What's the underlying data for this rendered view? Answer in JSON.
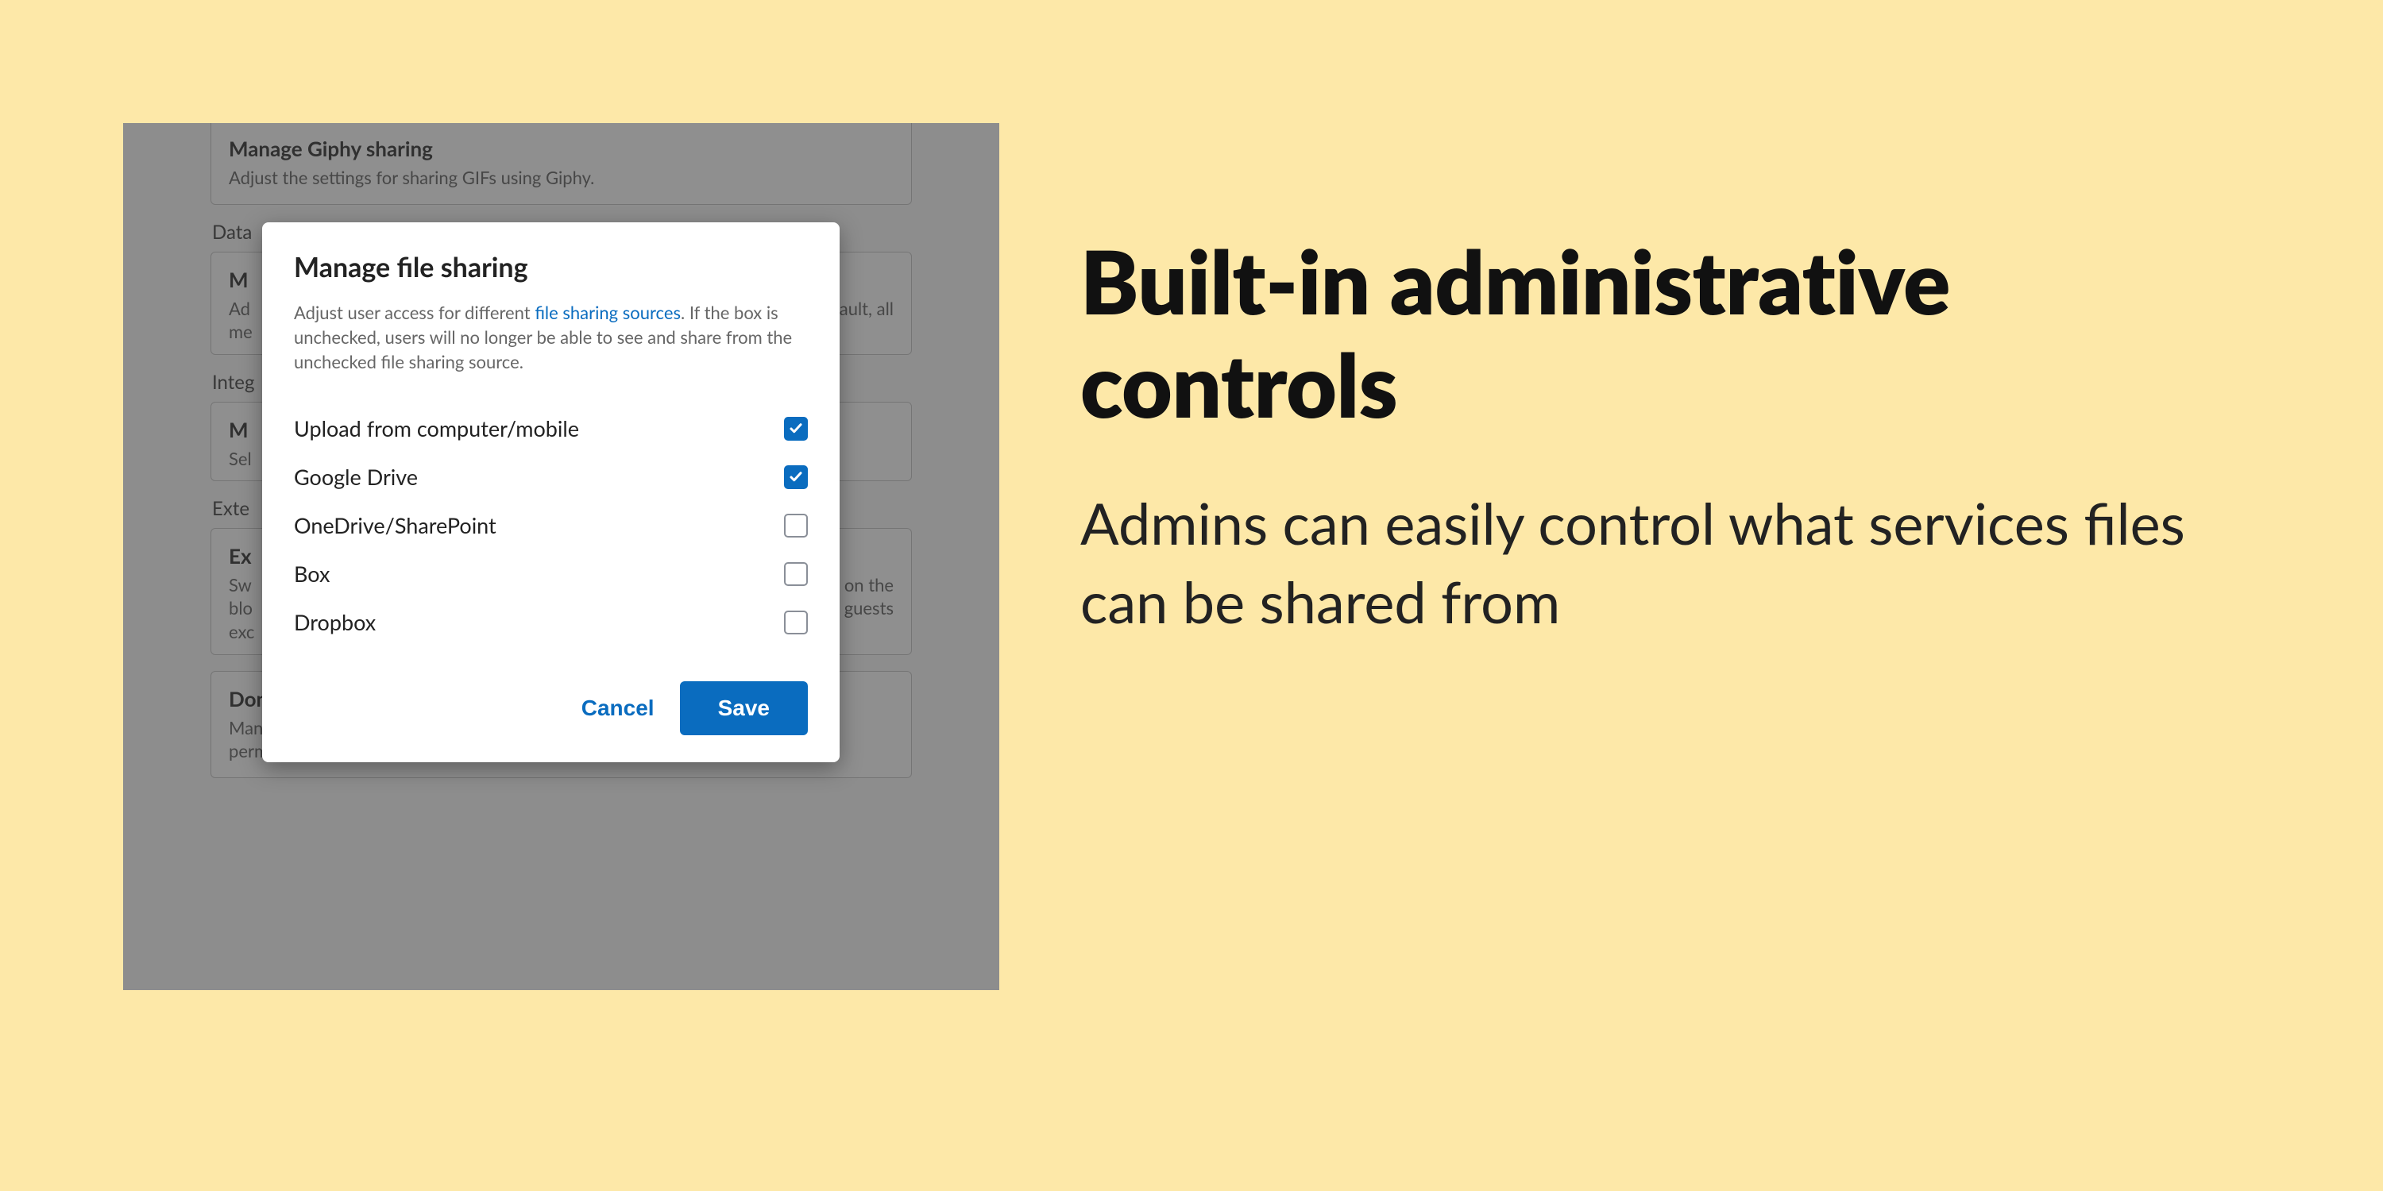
{
  "marketing": {
    "headline": "Built-in administrative controls",
    "subhead": "Admins can easily control what services files can be shared from"
  },
  "bg": {
    "card_giphy": {
      "title": "Manage Giphy sharing",
      "desc": "Adjust the settings for sharing GIFs using Giphy."
    },
    "section_data": "Data",
    "card_data": {
      "title_first": "M",
      "desc_prefix": "Ad",
      "desc_suffix": "By default, all",
      "desc_line2_prefix": "me"
    },
    "section_integ": "Integ",
    "card_integ": {
      "title_first": "M",
      "desc_prefix": "Sel"
    },
    "section_ext": "Exte",
    "card_ext1": {
      "title_first": "Ex",
      "desc_l1_prefix": "Sw",
      "desc_l1_suffix": "mains on the",
      "desc_l2_prefix": "blo",
      "desc_l2_suffix": "xternal guests",
      "desc_l3_prefix": "exc"
    },
    "card_ext2": {
      "title": "Domain allow/block list",
      "desc": "Manage which external company domains and personal email addresses have permission to initiate conversations with your users."
    }
  },
  "modal": {
    "title": "Manage file sharing",
    "desc_pre": "Adjust user access for different ",
    "desc_link": "file sharing sources",
    "desc_post": ". If the box is unchecked, users will no longer be able to see and share from the unchecked file sharing source.",
    "options": [
      {
        "label": "Upload from computer/mobile",
        "checked": true
      },
      {
        "label": "Google Drive",
        "checked": true
      },
      {
        "label": "OneDrive/SharePoint",
        "checked": false
      },
      {
        "label": "Box",
        "checked": false
      },
      {
        "label": "Dropbox",
        "checked": false
      }
    ],
    "cancel": "Cancel",
    "save": "Save"
  }
}
